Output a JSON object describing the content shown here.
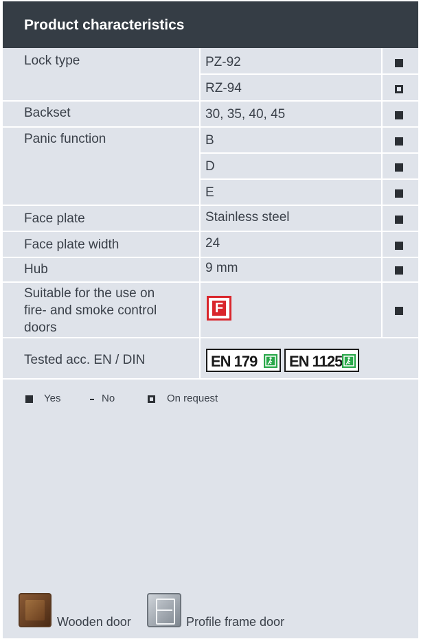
{
  "title": "Product characteristics",
  "rows": {
    "lock_type": {
      "label": "Lock type",
      "values": [
        "PZ-92",
        "RZ-94"
      ],
      "marks": [
        "yes",
        "on-request"
      ]
    },
    "backset": {
      "label": "Backset",
      "value": "30, 35, 40, 45",
      "mark": "yes"
    },
    "panic": {
      "label": "Panic function",
      "values": [
        "B",
        "D",
        "E"
      ],
      "marks": [
        "yes",
        "yes",
        "yes"
      ]
    },
    "face_plate": {
      "label": "Face plate",
      "value": "Stainless steel",
      "mark": "yes"
    },
    "face_plate_width": {
      "label": "Face plate width",
      "value": "24",
      "mark": "yes"
    },
    "hub": {
      "label": "Hub",
      "value": "9 mm",
      "mark": "yes"
    },
    "fire": {
      "label_lines": [
        "Suitable for the use on",
        "fire- and smoke control",
        "doors"
      ],
      "badge": "F",
      "mark": "yes"
    },
    "tested": {
      "label": "Tested acc. EN / DIN",
      "standards": [
        "EN 179",
        "EN 1125"
      ]
    }
  },
  "legend": {
    "yes": "Yes",
    "no": "No",
    "on_request": "On request"
  },
  "doors": {
    "wooden": "Wooden door",
    "profile": "Profile frame door"
  },
  "colors": {
    "header_bg": "#353d45",
    "panel_bg": "#dfe3ea",
    "fire_red": "#d9262c",
    "exit_green": "#2aa84a"
  }
}
